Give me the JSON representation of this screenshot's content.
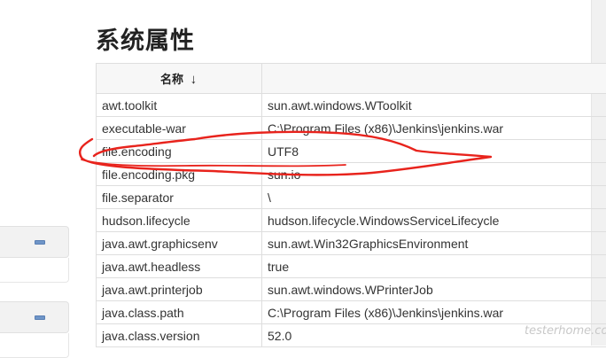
{
  "page": {
    "title": "系统属性",
    "watermark": "testerhome.com"
  },
  "table": {
    "columns": {
      "name": "名称",
      "sort_icon": "↓",
      "value": ""
    },
    "rows": [
      {
        "name": "awt.toolkit",
        "value": "sun.awt.windows.WToolkit"
      },
      {
        "name": "executable-war",
        "value": "C:\\Program Files (x86)\\Jenkins\\jenkins.war"
      },
      {
        "name": "file.encoding",
        "value": "UTF8"
      },
      {
        "name": "file.encoding.pkg",
        "value": "sun.io"
      },
      {
        "name": "file.separator",
        "value": "\\"
      },
      {
        "name": "hudson.lifecycle",
        "value": "hudson.lifecycle.WindowsServiceLifecycle"
      },
      {
        "name": "java.awt.graphicsenv",
        "value": "sun.awt.Win32GraphicsEnvironment"
      },
      {
        "name": "java.awt.headless",
        "value": "true"
      },
      {
        "name": "java.awt.printerjob",
        "value": "sun.awt.windows.WPrinterJob"
      },
      {
        "name": "java.class.path",
        "value": "C:\\Program Files (x86)\\Jenkins\\jenkins.war"
      },
      {
        "name": "java.class.version",
        "value": "52.0"
      }
    ]
  },
  "colors": {
    "annotation": "#e8231c",
    "collapse_button": "#6f95c8"
  }
}
